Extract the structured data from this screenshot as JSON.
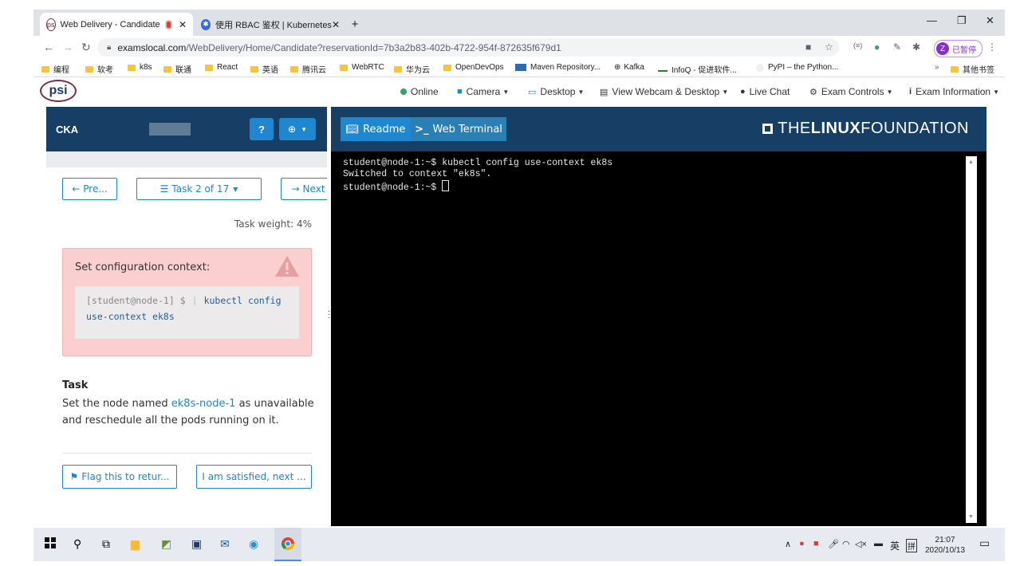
{
  "browser": {
    "tabs": [
      {
        "title": "Web Delivery - Candidate",
        "active": true
      },
      {
        "title": "使用 RBAC 鉴权 | Kubernetes",
        "active": false
      }
    ],
    "new_tab_symbol": "+",
    "url_host": "examslocal.com",
    "url_path": "/WebDelivery/Home/Candidate?reservationId=7b3a2b83-402b-4722-954f-872635f679d1",
    "profile_initial": "Z",
    "profile_label": "已暂停",
    "bookmarks": [
      "编程",
      "软考",
      "k8s",
      "联通",
      "React",
      "英语",
      "腾讯云",
      "WebRTC",
      "华为云",
      "OpenDevOps",
      "Maven Repository...",
      "Kafka",
      "InfoQ - 促进软件...",
      "PyPI – the Python..."
    ],
    "bookmarks_more": "»",
    "bookmarks_other": "其他书签"
  },
  "psi": {
    "logo": "psi",
    "menu": {
      "online": "Online",
      "camera": "Camera",
      "desktop": "Desktop",
      "view": "View Webcam & Desktop",
      "chat": "Live Chat",
      "controls": "Exam Controls",
      "info": "Exam Information"
    }
  },
  "left": {
    "exam": "CKA",
    "help": "?",
    "prev": "Pre...",
    "task_selector": "Task 2 of 17",
    "next": "Next",
    "weight": "Task weight: 4%",
    "alert_title": "Set configuration context:",
    "prompt": "[student@node-1] $",
    "command": "kubectl config use-context ek8s",
    "task_label": "Task",
    "task_pre": "Set the node named ",
    "task_node": "ek8s-node-1",
    "task_post": " as unavailable and reschedule all the pods running on it.",
    "flag": "Flag this to retur...",
    "satisfied": "I am satisfied, next ..."
  },
  "right": {
    "tab_readme": "Readme",
    "tab_terminal": "Web Terminal",
    "brand_the": "THE",
    "brand_linux": "LINUX",
    "brand_foundation": "FOUNDATION",
    "terminal_lines": [
      "student@node-1:~$ kubectl config use-context ek8s",
      "Switched to context \"ek8s\".",
      "student@node-1:~$ "
    ]
  },
  "taskbar": {
    "time": "21:07",
    "date": "2020/10/13",
    "ime_lang": "英",
    "ime_mode": "拼"
  },
  "colors": {
    "header_navy": "#173f66",
    "accent_blue": "#1f86d0",
    "alert_pink": "#fbcfcf",
    "online_green": "#2ea36b"
  }
}
